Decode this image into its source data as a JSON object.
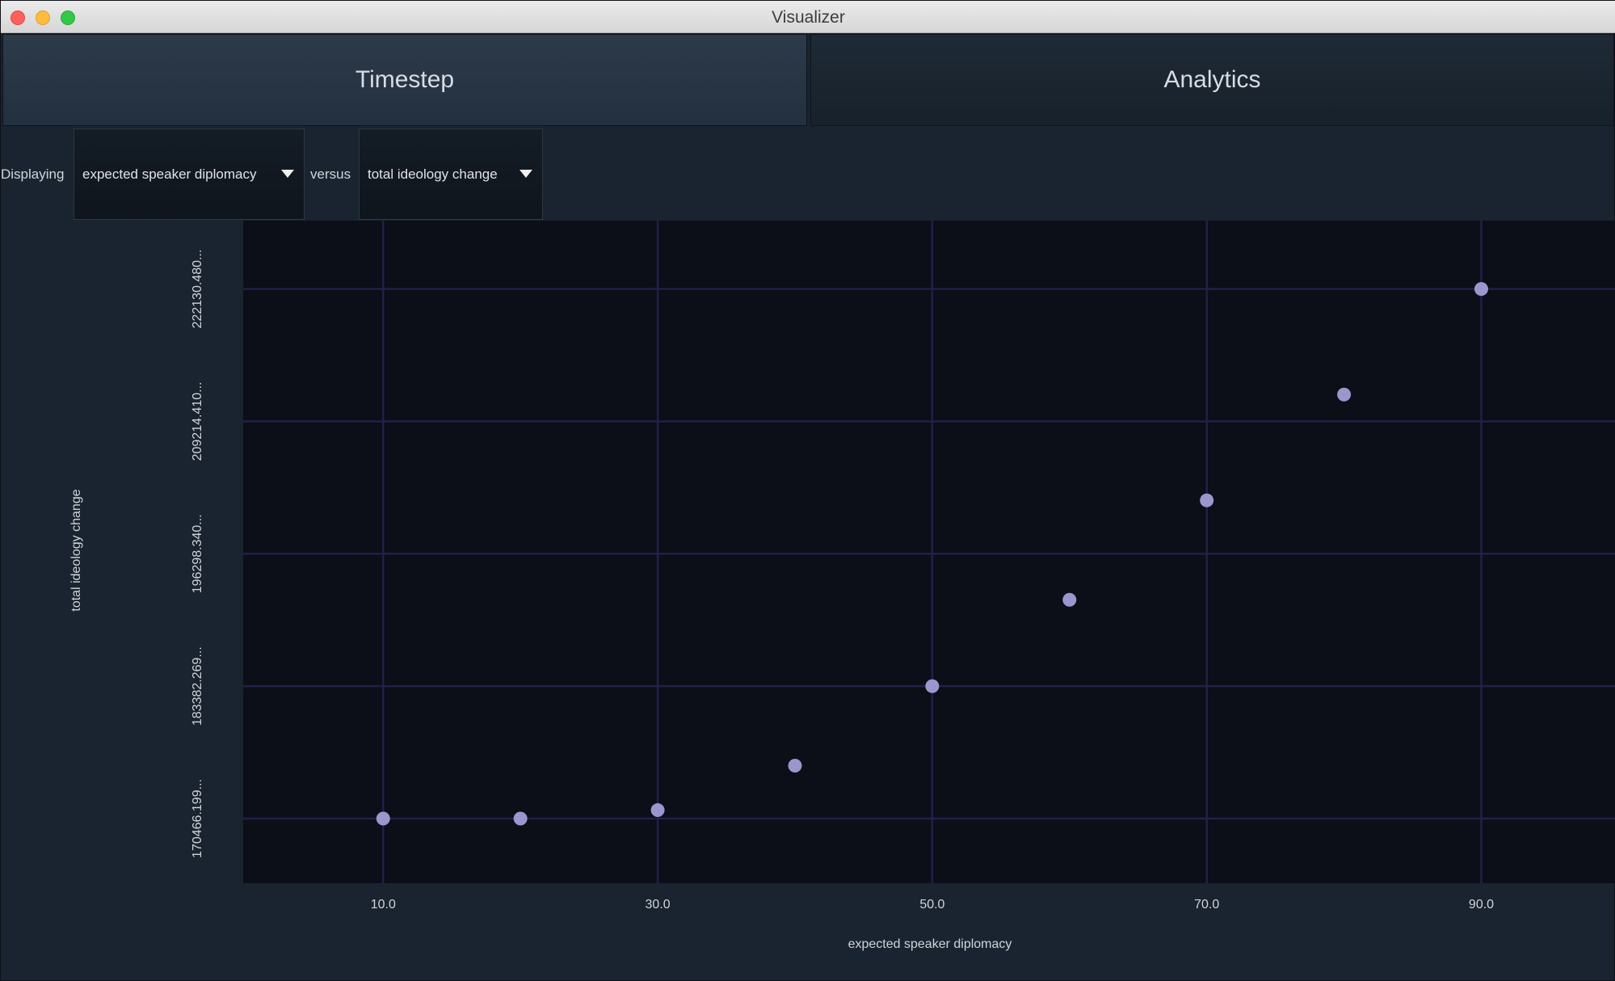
{
  "window": {
    "title": "Visualizer"
  },
  "tabs": [
    {
      "label": "Timestep",
      "active": true
    },
    {
      "label": "Analytics",
      "active": false
    }
  ],
  "controls": {
    "displaying_label": "Displaying",
    "x_select": "expected speaker diplomacy",
    "versus_label": "versus",
    "y_select": "total ideology change"
  },
  "colors": {
    "plot_bg": "#0c0e18",
    "grid": "#241f48",
    "point": "#9c96cf",
    "panel_bg": "#1a2430"
  },
  "chart_data": {
    "type": "scatter",
    "xlabel": "expected speaker diplomacy",
    "ylabel": "total ideology change",
    "x_ticks": [
      10.0,
      30.0,
      50.0,
      70.0,
      90.0
    ],
    "x_tick_labels": [
      "10.0",
      "30.0",
      "50.0",
      "70.0",
      "90.0"
    ],
    "y_ticks": [
      170466.199,
      183382.269,
      196298.34,
      209214.41,
      222130.48
    ],
    "y_tick_labels": [
      "170466.199...",
      "183382.269...",
      "196298.340...",
      "209214.410...",
      "222130.480..."
    ],
    "xlim": [
      -0.2,
      99.8
    ],
    "ylim": [
      164160,
      228800
    ],
    "grid": true,
    "points": [
      {
        "x": 10,
        "y": 170466.199
      },
      {
        "x": 20,
        "y": 170466.199
      },
      {
        "x": 30,
        "y": 171290
      },
      {
        "x": 40,
        "y": 175630
      },
      {
        "x": 50,
        "y": 183382.269
      },
      {
        "x": 60,
        "y": 191810
      },
      {
        "x": 70,
        "y": 201510
      },
      {
        "x": 80,
        "y": 211830
      },
      {
        "x": 90,
        "y": 222130.48
      }
    ]
  }
}
